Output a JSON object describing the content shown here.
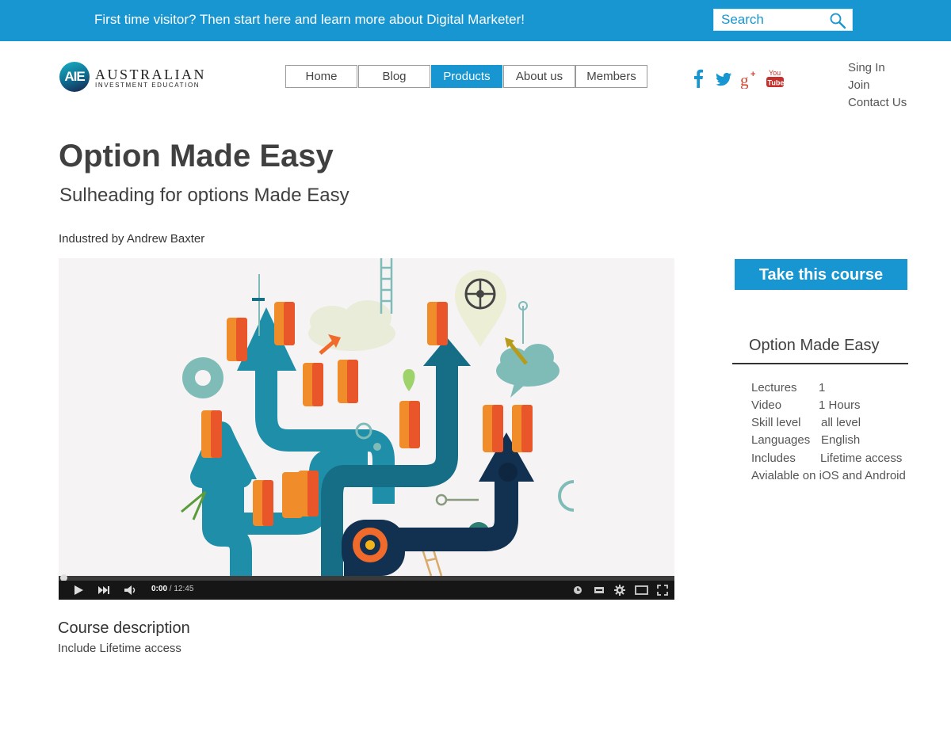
{
  "banner": {
    "text": "First time visitor? Then start here and learn more about Digital Marketer!",
    "search_placeholder": "Search"
  },
  "logo": {
    "mark": "AIE",
    "name": "AUSTRALIAN",
    "tagline": "Investment Education"
  },
  "nav": {
    "items": [
      {
        "label": "Home"
      },
      {
        "label": "Blog"
      },
      {
        "label": "Products"
      },
      {
        "label": "About us"
      },
      {
        "label": "Members"
      }
    ],
    "active": "Products"
  },
  "social": [
    "facebook-icon",
    "twitter-icon",
    "google-plus-icon",
    "youtube-icon"
  ],
  "account_links": [
    "Sing In",
    "Join",
    "Contact Us"
  ],
  "course": {
    "title": "Option Made Easy",
    "subtitle": "Sulheading for options Made Easy",
    "instructor": "Industred by Andrew Baxter"
  },
  "video": {
    "current_time": "0:00",
    "duration": "/ 12:45",
    "progress": 0
  },
  "sidebar": {
    "cta_label": "Take this course",
    "info_title": "Option Made Easy",
    "rows": [
      {
        "label": "Lectures",
        "value": "1"
      },
      {
        "label": "Video",
        "value": "1 Hours"
      },
      {
        "label": "Skill level",
        "value": "all level"
      },
      {
        "label": "Languages",
        "value": "English"
      },
      {
        "label": "Includes",
        "value": "Lifetime access"
      },
      {
        "label": "Avialable on iOS and Android",
        "value": ""
      }
    ]
  },
  "description": {
    "title": "Course description",
    "text": "Include Lifetime access"
  },
  "colors": {
    "brand_blue": "#1796d1",
    "text_dark": "#404040"
  }
}
